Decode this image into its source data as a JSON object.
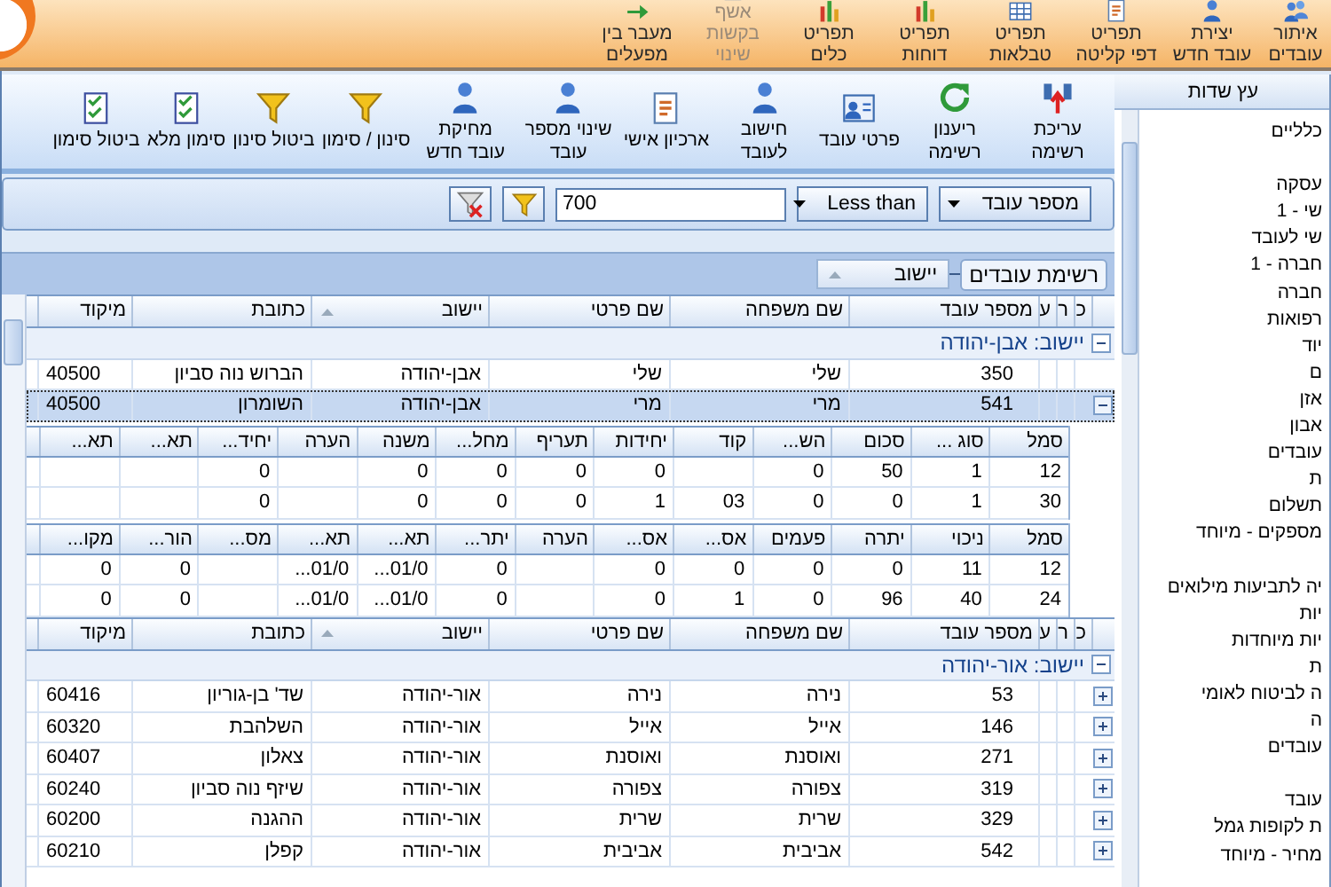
{
  "ribbon": {
    "buttons": [
      {
        "label": "איתור עובדים",
        "disabled": false
      },
      {
        "label": "יצירת עובד חדש",
        "disabled": false
      },
      {
        "label": "תפריט דפי קליטה",
        "disabled": false
      },
      {
        "label": "תפריט טבלאות",
        "disabled": false
      },
      {
        "label": "תפריט דוחות",
        "disabled": false
      },
      {
        "label": "תפריט כלים",
        "disabled": false
      },
      {
        "label": "אשף בקשות שינוי",
        "disabled": true
      },
      {
        "label": "מעבר בין מפעלים",
        "disabled": false
      }
    ]
  },
  "toolbar": {
    "buttons": [
      "עריכת רשימה",
      "ריענון רשימה",
      "פרטי עובד",
      "חישוב לעובד",
      "ארכיון אישי",
      "שינוי מספר עובד",
      "מחיקת עובד חדש",
      "סינון / סימון",
      "ביטול סינון",
      "סימון מלא",
      "ביטול סימון"
    ]
  },
  "filter": {
    "field": "מספר עובד",
    "operator": "Less than",
    "value": "700"
  },
  "group_panel": {
    "title": "רשימת עובדים",
    "chip": "יישוב"
  },
  "grid": {
    "sections": [
      {
        "columns": [
          {
            "label": "כ"
          },
          {
            "label": "ר"
          },
          {
            "label": "ע"
          },
          {
            "label": "מספר עובד"
          },
          {
            "label": "שם משפחה"
          },
          {
            "label": "שם פרטי"
          },
          {
            "label": "יישוב",
            "sorted": true
          },
          {
            "label": "כתובת"
          },
          {
            "label": "מיקוד"
          }
        ],
        "group": "יישוב: אבן-יהודה",
        "expanded": true,
        "rows": [
          {
            "cells": [
              null,
              null,
              null,
              "350",
              "שלי",
              "שלי",
              "אבן-יהודה",
              "הברוש נוה סביון",
              "40500"
            ],
            "selected": false
          },
          {
            "cells": [
              null,
              null,
              null,
              "541",
              "מרי",
              "מרי",
              "אבן-יהודה",
              "השומרון",
              "40500"
            ],
            "selected": true,
            "expanded": true,
            "details": [
              {
                "columns": [
                  "סמל",
                  "סוג ...",
                  "סכום",
                  "הש...",
                  "קוד",
                  "יחידות",
                  "תעריף",
                  "מחל...",
                  "משנה",
                  "הערה",
                  "יחיד...",
                  "תא...",
                  "תא..."
                ],
                "rows": [
                  [
                    "12",
                    "1",
                    "50",
                    "0",
                    null,
                    "0",
                    "0",
                    "0",
                    "0",
                    null,
                    "0",
                    null,
                    null
                  ],
                  [
                    "30",
                    "1",
                    "0",
                    "0",
                    "03",
                    "1",
                    "0",
                    "0",
                    "0",
                    null,
                    "0",
                    null,
                    null
                  ]
                ]
              },
              {
                "columns": [
                  "סמל",
                  "ניכוי",
                  "יתרה",
                  "פעמים",
                  "אס...",
                  "אס...",
                  "הערה",
                  "יתר...",
                  "תא...",
                  "תא...",
                  "מס...",
                  "הור...",
                  "מקו..."
                ],
                "rows": [
                  [
                    "12",
                    "11",
                    "0",
                    "0",
                    "0",
                    "0",
                    null,
                    "0",
                    "01/0...",
                    "01/0...",
                    null,
                    "0",
                    "0"
                  ],
                  [
                    "24",
                    "40",
                    "96",
                    "0",
                    "1",
                    "0",
                    null,
                    "0",
                    "01/0...",
                    "01/0...",
                    null,
                    "0",
                    "0"
                  ]
                ]
              }
            ]
          }
        ]
      },
      {
        "columns": [
          {
            "label": "כ"
          },
          {
            "label": "ר"
          },
          {
            "label": "ע"
          },
          {
            "label": "מספר עובד"
          },
          {
            "label": "שם משפחה"
          },
          {
            "label": "שם פרטי"
          },
          {
            "label": "יישוב",
            "sorted": true
          },
          {
            "label": "כתובת"
          },
          {
            "label": "מיקוד"
          }
        ],
        "group": "יישוב: אור-יהודה",
        "expanded": true,
        "rows": [
          {
            "cells": [
              null,
              null,
              null,
              "53",
              "נירה",
              "נירה",
              "אור-יהודה",
              "שד' בן-גוריון",
              "60416"
            ],
            "selected": false,
            "expanded": false
          },
          {
            "cells": [
              null,
              null,
              null,
              "146",
              "אייל",
              "אייל",
              "אור-יהודה",
              "השלהבת",
              "60320"
            ],
            "selected": false,
            "expanded": false
          },
          {
            "cells": [
              null,
              null,
              null,
              "271",
              "ואוסנת",
              "ואוסנת",
              "אור-יהודה",
              "צאלון",
              "60407"
            ],
            "selected": false,
            "expanded": false
          },
          {
            "cells": [
              null,
              null,
              null,
              "319",
              "צפורה",
              "צפורה",
              "אור-יהודה",
              "שיזף נוה סביון",
              "60240"
            ],
            "selected": false,
            "expanded": false
          },
          {
            "cells": [
              null,
              null,
              null,
              "329",
              "שרית",
              "שרית",
              "אור-יהודה",
              "ההגנה",
              "60200"
            ],
            "selected": false,
            "expanded": false
          },
          {
            "cells": [
              null,
              null,
              null,
              "542",
              "אביבית",
              "אביבית",
              "אור-יהודה",
              "קפלן",
              "60210"
            ],
            "selected": false,
            "expanded": false
          }
        ]
      }
    ]
  },
  "field_tree": {
    "title": "עץ שדות",
    "items": [
      {
        "kind": "text",
        "text": "כלליים"
      },
      {
        "kind": "blank"
      },
      {
        "kind": "text",
        "text": "עסקה"
      },
      {
        "kind": "text",
        "text": "שי - 1"
      },
      {
        "kind": "text",
        "text": "שי לעובד"
      },
      {
        "kind": "text",
        "text": "חברה - 1"
      },
      {
        "kind": "text",
        "text": "חברה"
      },
      {
        "kind": "text",
        "text": "רפואות"
      },
      {
        "kind": "text",
        "text": "יוד"
      },
      {
        "kind": "text",
        "text": "ם"
      },
      {
        "kind": "text",
        "text": "אזן"
      },
      {
        "kind": "text",
        "text": "אבון"
      },
      {
        "kind": "text",
        "text": "עובדים"
      },
      {
        "kind": "text",
        "text": "ת"
      },
      {
        "kind": "text",
        "text": "תשלום"
      },
      {
        "kind": "text",
        "text": "מספקים - מיוחד"
      },
      {
        "kind": "blank"
      },
      {
        "kind": "text",
        "text": "יה לתביעות מילואים"
      },
      {
        "kind": "text",
        "text": "יות"
      },
      {
        "kind": "text",
        "text": "יות מיוחדות"
      },
      {
        "kind": "text",
        "text": "ת"
      },
      {
        "kind": "text",
        "text": "ה לביטוח לאומי"
      },
      {
        "kind": "text",
        "text": "ה"
      },
      {
        "kind": "text",
        "text": "עובדים"
      },
      {
        "kind": "blank"
      },
      {
        "kind": "text",
        "text": "עובד"
      },
      {
        "kind": "text",
        "text": "ת לקופות גמל"
      },
      {
        "kind": "text",
        "text": "מחיר - מיוחד"
      }
    ]
  }
}
